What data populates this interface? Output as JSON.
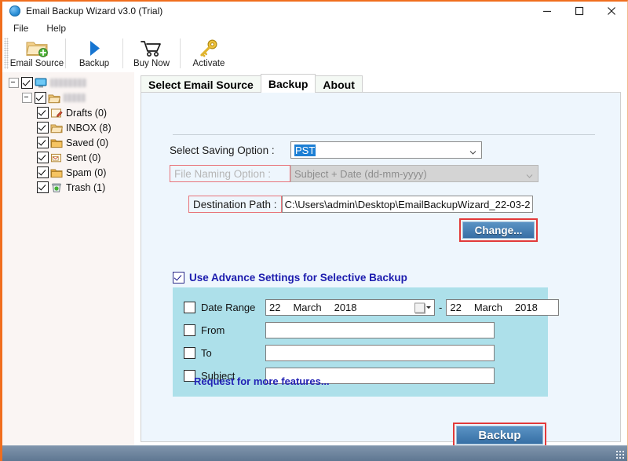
{
  "window": {
    "title": "Email Backup Wizard v3.0 (Trial)",
    "title_icon": "app-globe-icon",
    "minimize": "–",
    "maximize": "□",
    "close": "×"
  },
  "menubar": {
    "items": [
      {
        "label": "File"
      },
      {
        "label": "Help"
      }
    ]
  },
  "toolbar": {
    "buttons": [
      {
        "label": "Email Source",
        "icon": "folder-add-icon"
      },
      {
        "label": "Backup",
        "icon": "play-triangle-icon"
      },
      {
        "label": "Buy Now",
        "icon": "shopping-cart-icon"
      },
      {
        "label": "Activate",
        "icon": "key-icon"
      }
    ]
  },
  "sidebar": {
    "tree": [
      {
        "level": 0,
        "label": "",
        "redacted": true,
        "icon": "computer-icon",
        "checked": true,
        "expander": true
      },
      {
        "level": 1,
        "label": "",
        "redacted": true,
        "icon": "mail-folder-icon",
        "checked": true,
        "expander": true
      },
      {
        "level": 2,
        "label": "Drafts (0)",
        "icon": "drafts-folder-icon",
        "checked": true
      },
      {
        "level": 2,
        "label": "INBOX (8)",
        "icon": "inbox-folder-icon",
        "checked": true
      },
      {
        "level": 2,
        "label": "Saved (0)",
        "icon": "saved-folder-icon",
        "checked": true
      },
      {
        "level": 2,
        "label": "Sent (0)",
        "icon": "sent-folder-icon",
        "checked": true
      },
      {
        "level": 2,
        "label": "Spam (0)",
        "icon": "spam-folder-icon",
        "checked": true
      },
      {
        "level": 2,
        "label": "Trash (1)",
        "icon": "trash-folder-icon",
        "checked": true
      }
    ]
  },
  "tabs": [
    {
      "label": "Select Email Source",
      "active": false
    },
    {
      "label": "Backup",
      "active": true
    },
    {
      "label": "About",
      "active": false
    }
  ],
  "form": {
    "saving_option_label": "Select Saving Option :",
    "saving_option_value": "PST",
    "file_naming_label": "File Naming Option :",
    "file_naming_value": "Subject + Date (dd-mm-yyyy)",
    "destination_label": "Destination Path :",
    "destination_value": "C:\\Users\\admin\\Desktop\\EmailBackupWizard_22-03-2",
    "change_button": "Change..."
  },
  "advanced": {
    "title": "Use Advance Settings for Selective Backup",
    "date_range_label": "Date Range",
    "date_from_day": "22",
    "date_from_month": "March",
    "date_from_year": "2018",
    "date_separator": "-",
    "date_to_day": "22",
    "date_to_month": "March",
    "date_to_year": "2018",
    "from_label": "From",
    "from_value": "",
    "to_label": "To",
    "to_value": "",
    "subject_label": "Subject",
    "subject_value": "",
    "request_link": "Request for more features..."
  },
  "actions": {
    "backup_button": "Backup"
  },
  "colors": {
    "window_accent": "#f06e1e",
    "panel_background": "#eef6fd",
    "advanced_panel": "#ade0ea",
    "primary_button": "#4b83b8",
    "focus_outline": "#e23a3a",
    "link": "#2323b5",
    "selection": "#1d7fd4"
  }
}
